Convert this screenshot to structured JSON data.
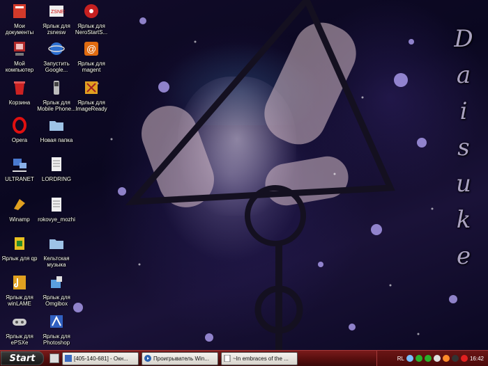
{
  "desktop": {
    "wallpaper_text": "Daisuke",
    "wallpaper_letters": [
      "D",
      "a",
      "i",
      "s",
      "u",
      "k",
      "e"
    ],
    "icons": [
      {
        "label": "Мои документы",
        "icon": "folder-docs-icon",
        "color": "#d23a2a"
      },
      {
        "label": "Ярлык для zsnesw",
        "icon": "snes-icon",
        "color": "#555555"
      },
      {
        "label": "Ярлык для NeroStartS...",
        "icon": "nero-icon",
        "color": "#c62020"
      },
      {
        "label": "Мой компьютер",
        "icon": "computer-icon",
        "color": "#b02a2a"
      },
      {
        "label": "Запустить Google...",
        "icon": "google-earth-icon",
        "color": "#2d6fd0"
      },
      {
        "label": "Ярлык для magent",
        "icon": "magent-icon",
        "color": "#e06b10"
      },
      {
        "label": "Корзина",
        "icon": "recycle-bin-icon",
        "color": "#cc2222"
      },
      {
        "label": "Ярлык для Mobile Phone...",
        "icon": "mobile-phone-icon",
        "color": "#bbbbbb"
      },
      {
        "label": "Ярлык для ImageReady",
        "icon": "imageready-icon",
        "color": "#e0a020"
      },
      {
        "label": "Opera",
        "icon": "opera-icon",
        "color": "#e01010"
      },
      {
        "label": "Новая папка",
        "icon": "folder-icon",
        "color": "#9ec3e6"
      },
      {
        "label": "ULTRANET",
        "icon": "network-icon",
        "color": "#4a7ad0"
      },
      {
        "label": "LORDRING",
        "icon": "text-document-icon",
        "color": "#f0f0f0"
      },
      {
        "label": "Winamp",
        "icon": "winamp-icon",
        "color": "#e0a020"
      },
      {
        "label": "rokovye_mozhi",
        "icon": "text-document-icon",
        "color": "#f0f0f0"
      },
      {
        "label": "Ярлык для qp",
        "icon": "qp-icon",
        "color": "#e8c020"
      },
      {
        "label": "Кельтская музыка",
        "icon": "folder-icon",
        "color": "#9ec3e6"
      },
      {
        "label": "Ярлык для winLAME",
        "icon": "winlame-icon",
        "color": "#e0a020"
      },
      {
        "label": "Ярлык для Omgibox",
        "icon": "omgibox-icon",
        "color": "#5aa0e0"
      },
      {
        "label": "Ярлык для ePSXe",
        "icon": "gamepad-icon",
        "color": "#cccccc"
      },
      {
        "label": "Ярлык для Photoshop",
        "icon": "photoshop-icon",
        "color": "#3060c0"
      }
    ]
  },
  "taskbar": {
    "start_label": "Start",
    "tasks": [
      {
        "label": "[405-140-681] - Окн..."
      },
      {
        "label": "Проигрыватель Win..."
      },
      {
        "label": "~In embraces of the ..."
      }
    ],
    "tray": {
      "language": "RL",
      "clock": "16:42"
    }
  },
  "colors": {
    "taskbar": "#5a0f0f",
    "start_button": "#1a1a1a"
  }
}
